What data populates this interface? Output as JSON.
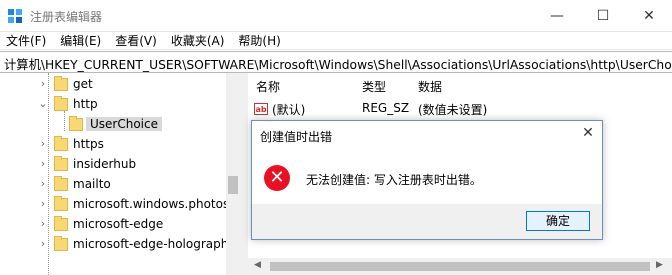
{
  "window": {
    "title": "注册表编辑器",
    "buttons": {
      "minimize": "—",
      "maximize": "☐",
      "close": "✕"
    }
  },
  "menu": [
    "文件(F)",
    "编辑(E)",
    "查看(V)",
    "收藏夹(A)",
    "帮助(H)"
  ],
  "address": "计算机\\HKEY_CURRENT_USER\\SOFTWARE\\Microsoft\\Windows\\Shell\\Associations\\UrlAssociations\\http\\UserChoice",
  "tree": [
    {
      "label": "get",
      "chevron": "›"
    },
    {
      "label": "http",
      "chevron": "⌄"
    },
    {
      "label": "UserChoice",
      "chevron": ""
    },
    {
      "label": "https",
      "chevron": "›"
    },
    {
      "label": "insiderhub",
      "chevron": "›"
    },
    {
      "label": "mailto",
      "chevron": "›"
    },
    {
      "label": "microsoft.windows.photos",
      "chevron": "›"
    },
    {
      "label": "microsoft-edge",
      "chevron": "›"
    },
    {
      "label": "microsoft-edge-holographi",
      "chevron": "›"
    }
  ],
  "values_pane": {
    "columns": [
      "名称",
      "类型",
      "数据"
    ],
    "rows": [
      {
        "name": "(默认)",
        "type": "REG_SZ",
        "data": "(数值未设置)",
        "icon": "ab"
      }
    ]
  },
  "dialog": {
    "title": "创建值时出错",
    "close": "✕",
    "icon": "✕",
    "message": "无法创建值: 写入注册表时出错。",
    "ok_label": "确定"
  },
  "colors": {
    "error_red": "#e81123",
    "accent": "#0078d7",
    "folder": "#f8d775"
  }
}
